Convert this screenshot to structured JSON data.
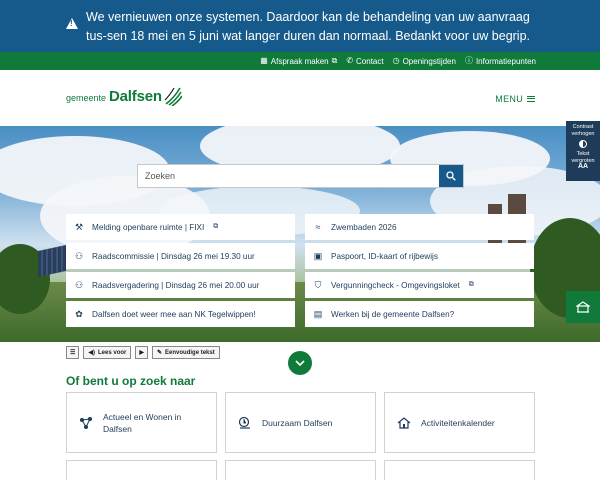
{
  "alert": {
    "text": "We vernieuwen onze systemen. Daardoor kan de behandeling van uw aanvraag tus-sen 18 mei en 5 juni wat langer duren dan normaal. Bedankt voor uw begrip.",
    "icon": "warning-icon"
  },
  "utility": {
    "items": [
      {
        "label": "Afspraak maken",
        "icon": "calendar-icon",
        "external": true
      },
      {
        "label": "Contact",
        "icon": "phone-icon"
      },
      {
        "label": "Openingstijden",
        "icon": "clock-icon"
      },
      {
        "label": "Informatiepunten",
        "icon": "info-icon"
      }
    ]
  },
  "header": {
    "logo_prefix": "gemeente",
    "logo_name": "Dalfsen",
    "menu_label": "MENU"
  },
  "search": {
    "placeholder": "Zoeken"
  },
  "quicklinks": [
    {
      "label": "Melding openbare ruimte | FIXI",
      "icon": "report-icon",
      "external": true
    },
    {
      "label": "Zwembaden 2026",
      "icon": "swimmer-icon"
    },
    {
      "label": "Raadscommissie | Dinsdag 26 mei 19.30 uur",
      "icon": "people-icon"
    },
    {
      "label": "Paspoort, ID-kaart of rijbewijs",
      "icon": "id-card-icon"
    },
    {
      "label": "Raadsvergadering | Dinsdag 26 mei 20.00 uur",
      "icon": "people-icon"
    },
    {
      "label": "Vergunningcheck - Omgevingsloket",
      "icon": "permit-icon",
      "external": true
    },
    {
      "label": "Dalfsen doet weer mee aan NK Tegelwippen!",
      "icon": "garden-icon"
    },
    {
      "label": "Werken bij de gemeente Dalfsen?",
      "icon": "briefcase-icon"
    }
  ],
  "accessibility": {
    "contrast_label_1": "Contrast",
    "contrast_label_2": "verhogen",
    "text_label_1": "Tekst",
    "text_label_2": "vergroten",
    "text_symbol": "AA"
  },
  "readbar": {
    "listen_label": "Lees voor",
    "simple_label": "Eenvoudige tekst"
  },
  "section": {
    "title": "Of bent u op zoek naar"
  },
  "cards": [
    {
      "label": "Actueel en Wonen in Dalfsen",
      "icon": "network-icon"
    },
    {
      "label": "Duurzaam Dalfsen",
      "icon": "sustainability-icon"
    },
    {
      "label": "Activiteitenkalender",
      "icon": "house-icon"
    }
  ]
}
